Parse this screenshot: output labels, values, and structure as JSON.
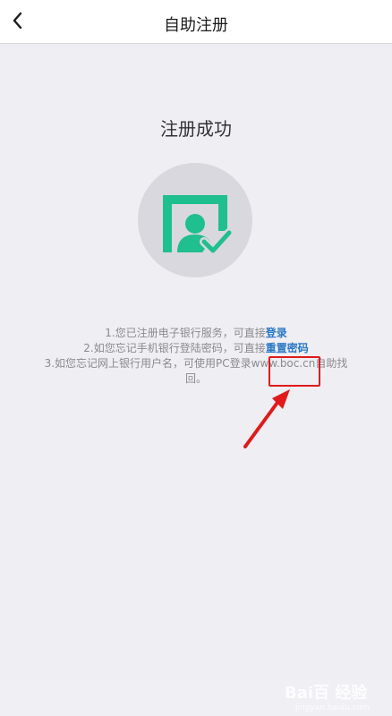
{
  "nav": {
    "title": "自助注册",
    "back_icon": "chevron-left-icon"
  },
  "main": {
    "success_title": "注册成功",
    "badge_icon": "user-verified-icon",
    "colors": {
      "accent": "#1fbf8f",
      "link": "#2a78c8",
      "highlight": "#e01a1a"
    },
    "info": {
      "line1_text": "1.您已注册电子银行服务，可直接",
      "line1_link": "登录",
      "line2_text": "2.如您忘记手机银行登陆密码，可直接",
      "line2_link": "重置密码",
      "line3_text": "3.如您忘记网上银行用户名，可使用PC登录www.boc.cn自助找",
      "line3_cont": "回。"
    }
  },
  "watermark": {
    "brand": "Bai百 经验",
    "sub": "jingyan.baidu.com"
  }
}
